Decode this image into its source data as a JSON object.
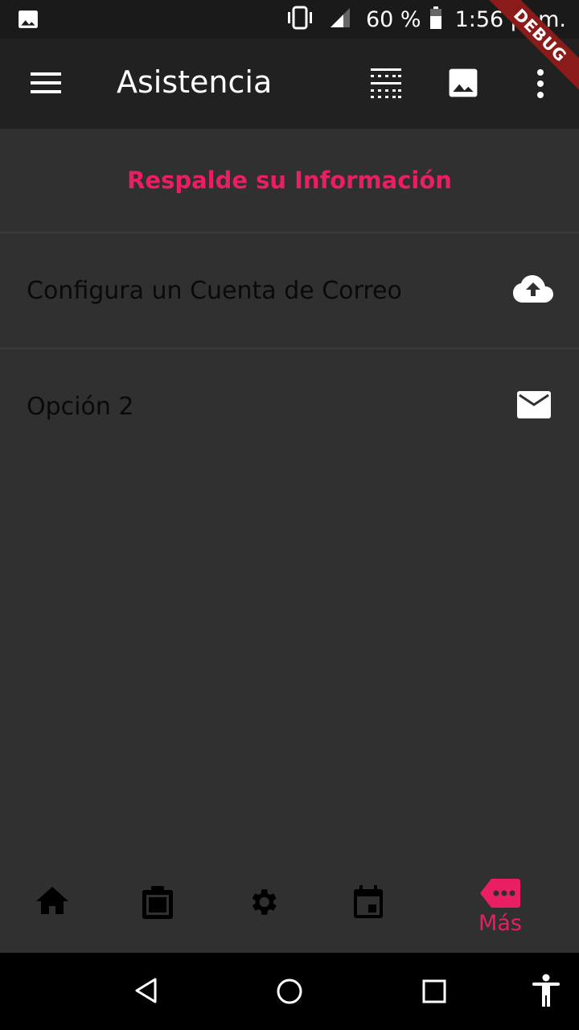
{
  "statusbar": {
    "battery": "60 %",
    "time": "1:56 p. m.",
    "icons": [
      "image-icon",
      "vibrate-icon",
      "signal-icon",
      "battery-icon"
    ]
  },
  "appbar": {
    "title": "Asistencia",
    "icons": [
      "menu-icon",
      "grid-icon",
      "image-icon",
      "more-vert-icon"
    ],
    "debug_banner": "DEBUG"
  },
  "content": {
    "section_title": "Respalde su Información",
    "items": [
      {
        "label": "Configura un Cuenta de Correo",
        "icon": "cloud-upload-icon"
      },
      {
        "label": "Opción 2",
        "icon": "mail-icon"
      }
    ]
  },
  "bottom_nav": {
    "items": [
      {
        "icon": "home-icon"
      },
      {
        "icon": "clipboard-icon"
      },
      {
        "icon": "settings-icon"
      },
      {
        "icon": "event-icon"
      },
      {
        "icon": "more-tag-icon",
        "label": "Más",
        "active": true
      }
    ]
  },
  "colors": {
    "accent": "#e91e63",
    "background": "#303030",
    "appbar": "#212121"
  }
}
